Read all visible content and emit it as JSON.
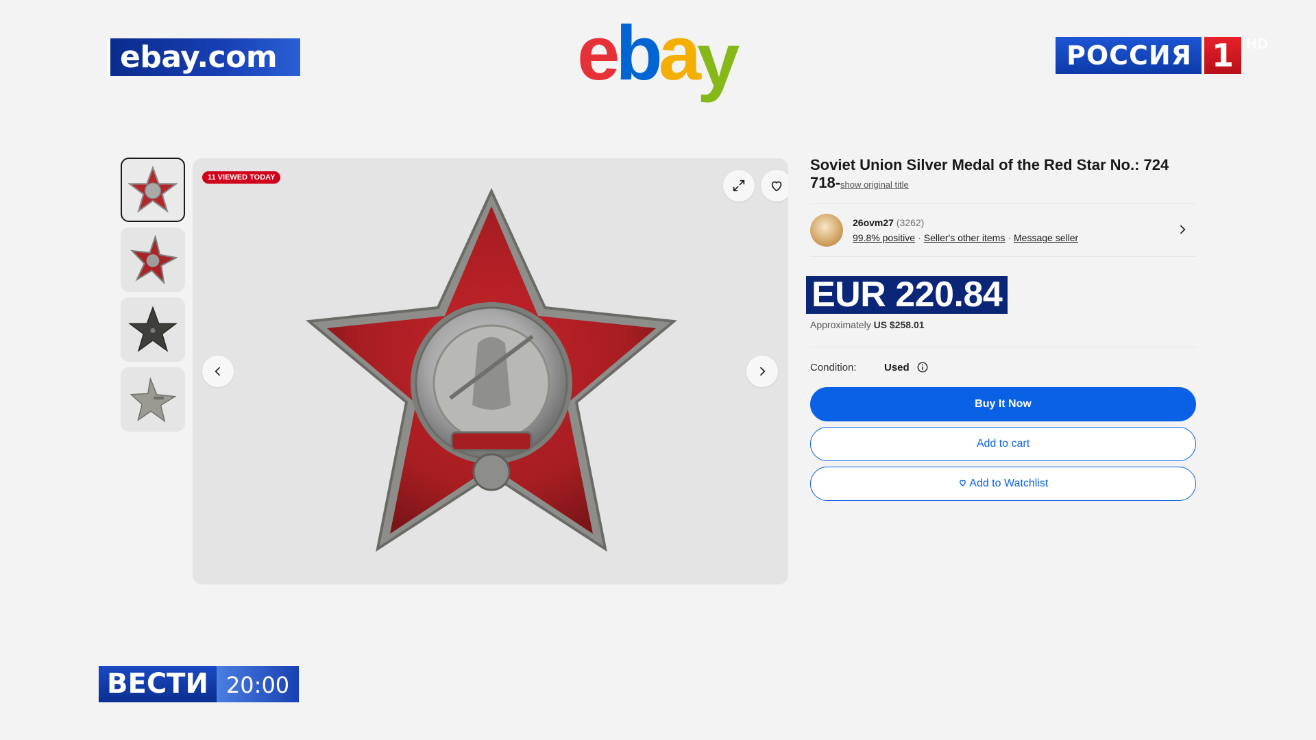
{
  "overlay": {
    "source_badge": "ebay.com",
    "channel_word": "РОССИЯ",
    "channel_number": "1",
    "channel_hd": "HD",
    "program_name": "ВЕСТИ",
    "program_time": "20:00"
  },
  "logo": {
    "letters": [
      "e",
      "b",
      "a",
      "y"
    ]
  },
  "gallery": {
    "viewed_badge": "11 VIEWED TODAY",
    "thumbnails": [
      "thumb-front",
      "thumb-angle",
      "thumb-back",
      "thumb-side"
    ],
    "active_index": 0
  },
  "listing": {
    "title": "Soviet Union Silver Medal of the Red Star No.: 724 718-",
    "show_original": "show original title",
    "seller": {
      "name": "26ovm27",
      "score": "(3262)",
      "positive": "99.8% positive",
      "other_items": "Seller's other items",
      "message": "Message seller",
      "separator": "·"
    },
    "price": "EUR 220.84",
    "approx_label": "Approximately",
    "approx_value": "US $258.01",
    "condition_label": "Condition:",
    "condition_value": "Used",
    "buy_now": "Buy It Now",
    "add_to_cart": "Add to cart",
    "add_to_watchlist": "Add to Watchlist"
  },
  "colors": {
    "ebay_red": "#e53238",
    "ebay_blue": "#0064d2",
    "ebay_yellow": "#f5af02",
    "ebay_green": "#86b817",
    "primary_button": "#0b61e6",
    "price_highlight": "#0b2577",
    "badge_red": "#d0021b"
  },
  "icons": [
    "expand-icon",
    "heart-icon",
    "chevron-left-icon",
    "chevron-right-icon",
    "info-icon"
  ]
}
